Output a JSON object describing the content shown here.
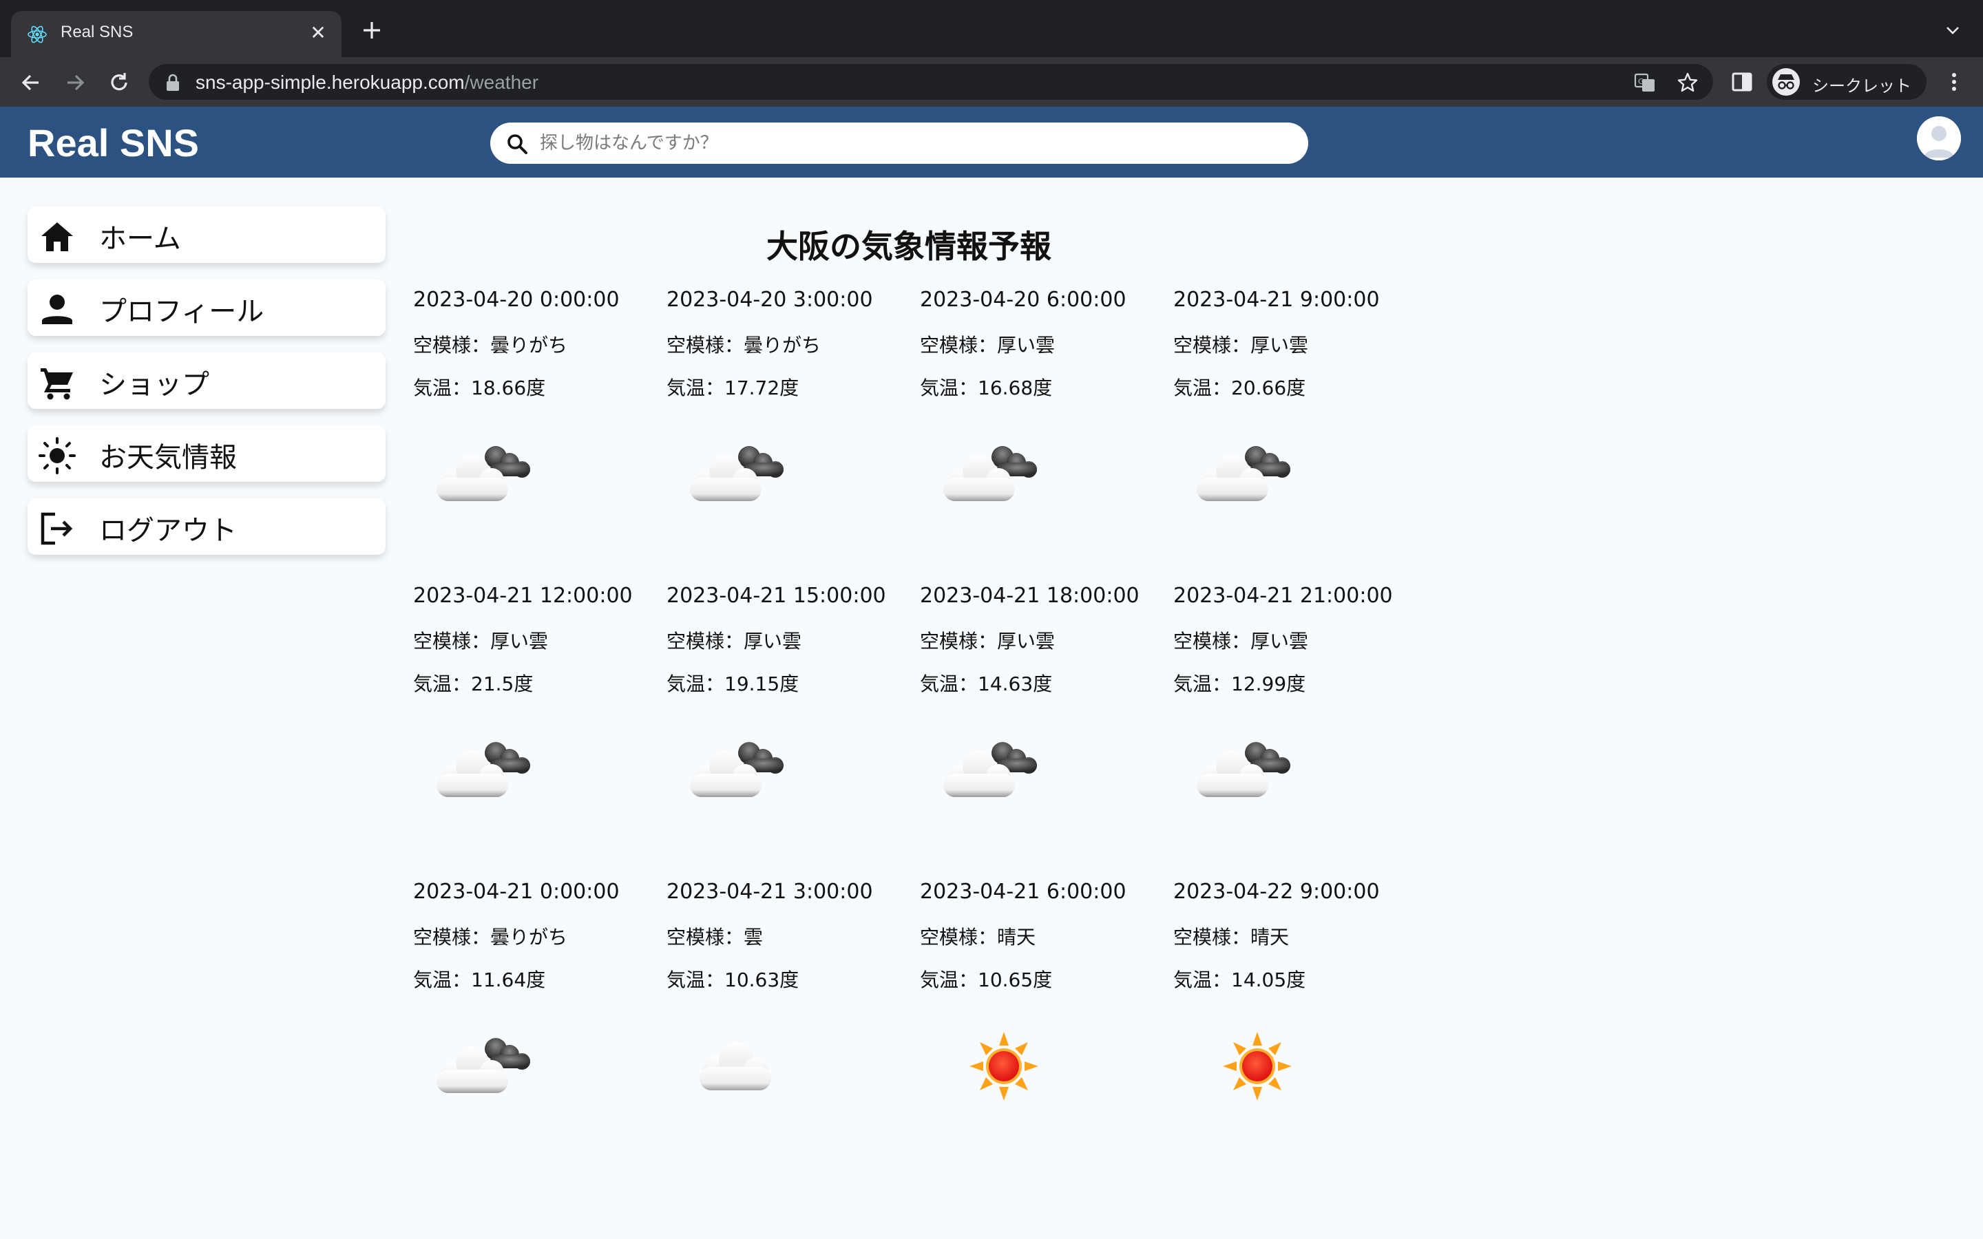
{
  "browser": {
    "tab_title": "Real SNS",
    "url_host": "sns-app-simple.herokuapp.com",
    "url_path": "/weather",
    "incognito_label": "シークレット"
  },
  "header": {
    "logo": "Real SNS",
    "search_placeholder": "探し物はなんですか？"
  },
  "sidebar": {
    "items": [
      {
        "label": "ホーム",
        "icon": "home-icon"
      },
      {
        "label": "プロフィール",
        "icon": "person-icon"
      },
      {
        "label": "ショップ",
        "icon": "cart-icon"
      },
      {
        "label": "お天気情報",
        "icon": "sun-icon"
      },
      {
        "label": "ログアウト",
        "icon": "logout-icon"
      }
    ]
  },
  "main": {
    "title": "大阪の気象情報予報",
    "forecasts": [
      {
        "time": "2023-04-20 0:00:00",
        "sky": "空模様：曇りがち",
        "temp": "気温：18.66度",
        "icon": "partly-cloudy"
      },
      {
        "time": "2023-04-20 3:00:00",
        "sky": "空模様：曇りがち",
        "temp": "気温：17.72度",
        "icon": "partly-cloudy"
      },
      {
        "time": "2023-04-20 6:00:00",
        "sky": "空模様：厚い雲",
        "temp": "気温：16.68度",
        "icon": "partly-cloudy"
      },
      {
        "time": "2023-04-21 9:00:00",
        "sky": "空模様：厚い雲",
        "temp": "気温：20.66度",
        "icon": "partly-cloudy"
      },
      {
        "time": "2023-04-21 12:00:00",
        "sky": "空模様：厚い雲",
        "temp": "気温：21.5度",
        "icon": "partly-cloudy"
      },
      {
        "time": "2023-04-21 15:00:00",
        "sky": "空模様：厚い雲",
        "temp": "気温：19.15度",
        "icon": "partly-cloudy"
      },
      {
        "time": "2023-04-21 18:00:00",
        "sky": "空模様：厚い雲",
        "temp": "気温：14.63度",
        "icon": "partly-cloudy"
      },
      {
        "time": "2023-04-21 21:00:00",
        "sky": "空模様：厚い雲",
        "temp": "気温：12.99度",
        "icon": "partly-cloudy"
      },
      {
        "time": "2023-04-21 0:00:00",
        "sky": "空模様：曇りがち",
        "temp": "気温：11.64度",
        "icon": "partly-cloudy"
      },
      {
        "time": "2023-04-21 3:00:00",
        "sky": "空模様：雲",
        "temp": "気温：10.63度",
        "icon": "cloud"
      },
      {
        "time": "2023-04-21 6:00:00",
        "sky": "空模様：晴天",
        "temp": "気温：10.65度",
        "icon": "sun"
      },
      {
        "time": "2023-04-22 9:00:00",
        "sky": "空模様：晴天",
        "temp": "気温：14.05度",
        "icon": "sun"
      }
    ]
  },
  "colors": {
    "header_bg": "#2c5282",
    "page_bg": "#f8fbfd",
    "chrome_dark": "#202124",
    "chrome_toolbar": "#35363a"
  }
}
